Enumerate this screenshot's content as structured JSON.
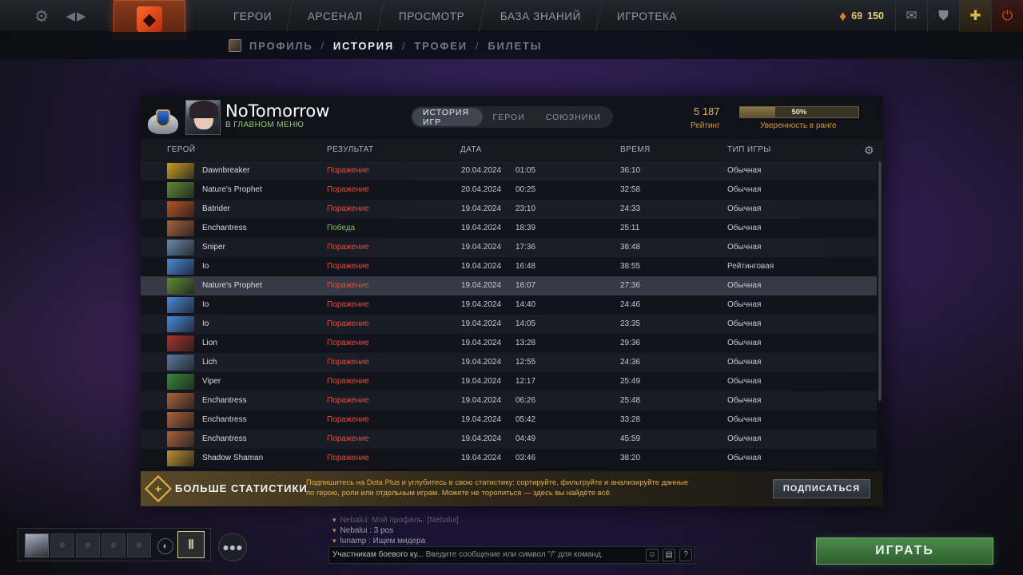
{
  "topbar": {
    "nav": [
      "ГЕРОИ",
      "АРСЕНАЛ",
      "ПРОСМОТР",
      "БАЗА ЗНАНИЙ",
      "ИГРОТЕКА"
    ],
    "currency_shards": "69",
    "currency_gold": "150"
  },
  "subnav": {
    "items": [
      "ПРОФИЛЬ",
      "ИСТОРИЯ",
      "ТРОФЕИ",
      "БИЛЕТЫ"
    ],
    "sep": "/"
  },
  "profile": {
    "name": "NoTomorrow",
    "status": "В ГЛАВНОМ МЕНЮ",
    "tabs": [
      "ИСТОРИЯ ИГР",
      "ГЕРОИ",
      "СОЮЗНИКИ"
    ],
    "rating_value": "5 187",
    "rating_label": "Рейтинг",
    "confidence_value": "50%",
    "confidence_fraction": 0.3,
    "confidence_label": "Уверенность в ранге"
  },
  "table": {
    "headers": [
      "ГЕРОЙ",
      "РЕЗУЛЬТАТ",
      "ДАТА",
      "ВРЕМЯ",
      "ТИП ИГРЫ"
    ],
    "rows": [
      {
        "hero": "Dawnbreaker",
        "result": "Поражение",
        "win": false,
        "date": "20.04.2024",
        "time": "01:05",
        "duration": "36:10",
        "type": "Обычная",
        "color": "#c9a020"
      },
      {
        "hero": "Nature's Prophet",
        "result": "Поражение",
        "win": false,
        "date": "20.04.2024",
        "time": "00:25",
        "duration": "32:58",
        "type": "Обычная",
        "color": "#5e8a32"
      },
      {
        "hero": "Batrider",
        "result": "Поражение",
        "win": false,
        "date": "19.04.2024",
        "time": "23:10",
        "duration": "24:33",
        "type": "Обычная",
        "color": "#b8541e"
      },
      {
        "hero": "Enchantress",
        "result": "Победа",
        "win": true,
        "date": "19.04.2024",
        "time": "18:39",
        "duration": "25:11",
        "type": "Обычная",
        "color": "#a8623a"
      },
      {
        "hero": "Sniper",
        "result": "Поражение",
        "win": false,
        "date": "19.04.2024",
        "time": "17:36",
        "duration": "38:48",
        "type": "Обычная",
        "color": "#6a8aa8"
      },
      {
        "hero": "Io",
        "result": "Поражение",
        "win": false,
        "date": "19.04.2024",
        "time": "16:48",
        "duration": "38:55",
        "type": "Рейтинговая",
        "color": "#4a8ad8"
      },
      {
        "hero": "Nature's Prophet",
        "result": "Поражение",
        "win": false,
        "date": "19.04.2024",
        "time": "16:07",
        "duration": "27:36",
        "type": "Обычная",
        "color": "#5e8a32"
      },
      {
        "hero": "Io",
        "result": "Поражение",
        "win": false,
        "date": "19.04.2024",
        "time": "14:40",
        "duration": "24:46",
        "type": "Обычная",
        "color": "#4a8ad8"
      },
      {
        "hero": "Io",
        "result": "Поражение",
        "win": false,
        "date": "19.04.2024",
        "time": "14:05",
        "duration": "23:35",
        "type": "Обычная",
        "color": "#4a8ad8"
      },
      {
        "hero": "Lion",
        "result": "Поражение",
        "win": false,
        "date": "19.04.2024",
        "time": "13:28",
        "duration": "29:36",
        "type": "Обычная",
        "color": "#a8322a"
      },
      {
        "hero": "Lich",
        "result": "Поражение",
        "win": false,
        "date": "19.04.2024",
        "time": "12:55",
        "duration": "24:36",
        "type": "Обычная",
        "color": "#5a7a9a"
      },
      {
        "hero": "Viper",
        "result": "Поражение",
        "win": false,
        "date": "19.04.2024",
        "time": "12:17",
        "duration": "25:49",
        "type": "Обычная",
        "color": "#3a8a3a"
      },
      {
        "hero": "Enchantress",
        "result": "Поражение",
        "win": false,
        "date": "19.04.2024",
        "time": "06:26",
        "duration": "25:48",
        "type": "Обычная",
        "color": "#a8623a"
      },
      {
        "hero": "Enchantress",
        "result": "Поражение",
        "win": false,
        "date": "19.04.2024",
        "time": "05:42",
        "duration": "33:28",
        "type": "Обычная",
        "color": "#a8623a"
      },
      {
        "hero": "Enchantress",
        "result": "Поражение",
        "win": false,
        "date": "19.04.2024",
        "time": "04:49",
        "duration": "45:59",
        "type": "Обычная",
        "color": "#a8623a"
      },
      {
        "hero": "Shadow Shaman",
        "result": "Поражение",
        "win": false,
        "date": "19.04.2024",
        "time": "03:46",
        "duration": "38:20",
        "type": "Обычная",
        "color": "#b89030"
      }
    ]
  },
  "dotaplus": {
    "title": "БОЛЬШЕ СТАТИСТИКИ",
    "desc": "Подпишитесь на Dota Plus и углубитесь в свою статистику: сортируйте, фильтруйте и анализируйте данные по герою, роли или отдельным играм. Можете не торопиться — здесь вы найдёте всё.",
    "button": "ПОДПИСАТЬСЯ"
  },
  "chat": {
    "lines": [
      {
        "text": "Nebalui: Мой профиль: [Nebalui]",
        "faded": true
      },
      {
        "text": "Nebalui : 3 pos",
        "faded": false
      },
      {
        "text": "lunamp  : Ищем мидера",
        "faded": false
      }
    ],
    "channel": "Участникам боевого ку...",
    "placeholder": "Введите сообщение или символ \"/\" для команд."
  },
  "play_button": "ИГРАТЬ"
}
